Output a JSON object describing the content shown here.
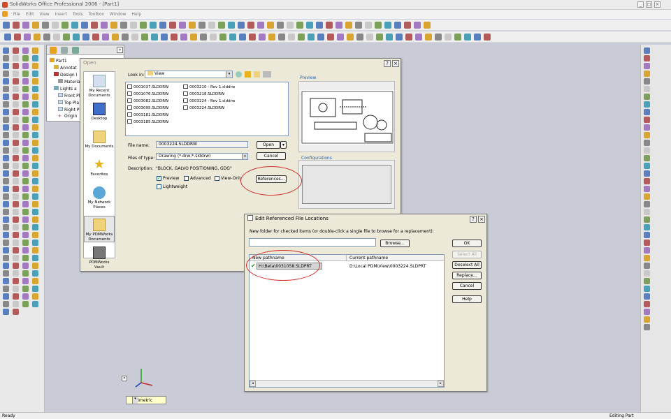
{
  "app": {
    "title": "SolidWorks Office Professional 2006 - [Part1]"
  },
  "menu": [
    "File",
    "Edit",
    "View",
    "Insert",
    "Tools",
    "Toolbox",
    "Window",
    "Help"
  ],
  "feature_tree": {
    "items": [
      "Part1",
      "Annotat",
      "Design I",
      "Materia",
      "Lights a",
      "Front Pl",
      "Top Pla",
      "Right Pl",
      "Origin"
    ]
  },
  "open_dialog": {
    "title": "Open",
    "look_in_label": "Look in:",
    "look_in_value": "View",
    "places": [
      "My Recent Documents",
      "Desktop",
      "My Documents",
      "Favorites",
      "My Network Places",
      "My PDMWorks Documents",
      "PDMWorks Vault"
    ],
    "files_col1": [
      "0001037.SLDDRW",
      "0001076.SLDDRW",
      "0003082.SLDDRW",
      "0003095.SLDDRW",
      "0003181.SLDDRW",
      "0003185.SLDDRW"
    ],
    "files_col2": [
      "0003210 - Rev 1.slddrw",
      "0003218.SLDDRW",
      "0003224 - Rev 1.slddrw",
      "0003224.SLDDRW"
    ],
    "preview_label": "Preview",
    "configurations_label": "Configurations",
    "file_name_label": "File name:",
    "file_name_value": "0003224.SLDDRW",
    "files_of_type_label": "Files of type:",
    "files_of_type_value": "Drawing (*.drw;*.slddrw)",
    "description_label": "Description:",
    "description_value": "\"BLOCK, GALVO POSITIONING, GDG\"",
    "open_btn": "Open",
    "cancel_btn": "Cancel",
    "references_btn": "References...",
    "chk_preview": "Preview",
    "chk_advanced": "Advanced",
    "chk_viewonly": "View-Only",
    "chk_lightweight": "Lightweight"
  },
  "erfl_dialog": {
    "title": "Edit Referenced File Locations",
    "instruction": "New folder for checked items (or double-click a single file to browse for a replacement):",
    "browse_btn": "Browse...",
    "col_new": "New pathname",
    "col_current": "Current pathname",
    "row_new": "H:\\Beta\\0031058.SLDPRT",
    "row_current": "D:\\Local PDM\\View\\0003224.SLDPRT",
    "ok_btn": "OK",
    "select_all_btn": "Select All",
    "deselect_all_btn": "Deselect All",
    "replace_btn": "Replace...",
    "cancel_btn": "Cancel",
    "help_btn": "Help"
  },
  "view": {
    "orientation": "*Trimetric"
  },
  "status": {
    "left": "Ready",
    "right": "Editing Part"
  }
}
